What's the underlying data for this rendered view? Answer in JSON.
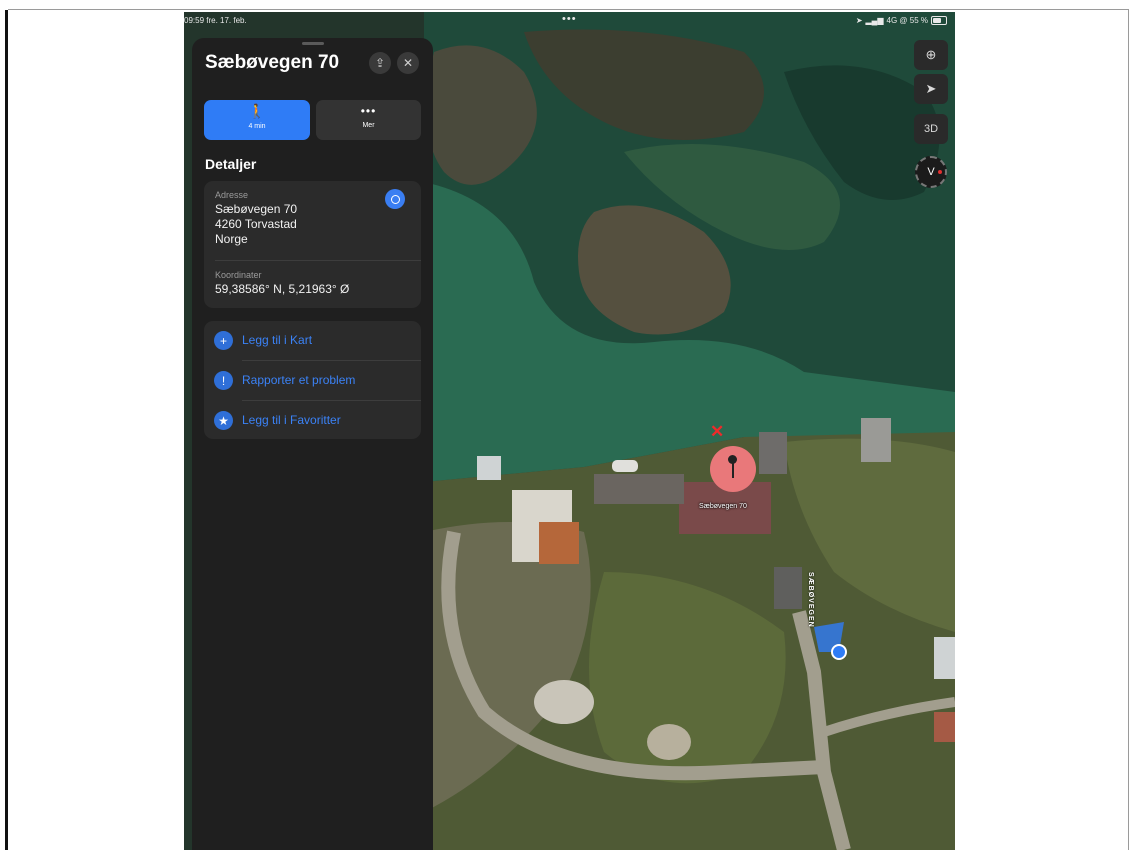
{
  "status_bar": {
    "time_date": "09:59  fre. 17. feb.",
    "center_dots": "•••",
    "right_status": "4G @ 55 %"
  },
  "panel": {
    "title": "Sæbøvegen 70",
    "walk_button": {
      "icon": "walk-icon",
      "label": "4 min"
    },
    "more_button": {
      "icon": "ellipsis-icon",
      "label": "Mer"
    },
    "details_heading": "Detaljer",
    "address_label": "Adresse",
    "address_lines": [
      "Sæbøvegen 70",
      "4260 Torvastad",
      "Norge"
    ],
    "coordinates_label": "Koordinater",
    "coordinates_value": "59,38586° N, 5,21963° Ø",
    "actions": [
      {
        "icon": "plus-icon",
        "label": "Legg til i Kart"
      },
      {
        "icon": "exclamation-icon",
        "label": "Rapporter et problem"
      },
      {
        "icon": "star-icon",
        "label": "Legg til i Favoritter"
      }
    ]
  },
  "map": {
    "pin_label": "Sæbøvegen 70",
    "road_label": "SÆBØVEGEN",
    "controls": {
      "three_d": "3D",
      "compass_letter": "V"
    }
  },
  "colors": {
    "accent": "#2f7cf6",
    "pin": "#e9787a",
    "panel_bg": "#1f1f1f"
  }
}
